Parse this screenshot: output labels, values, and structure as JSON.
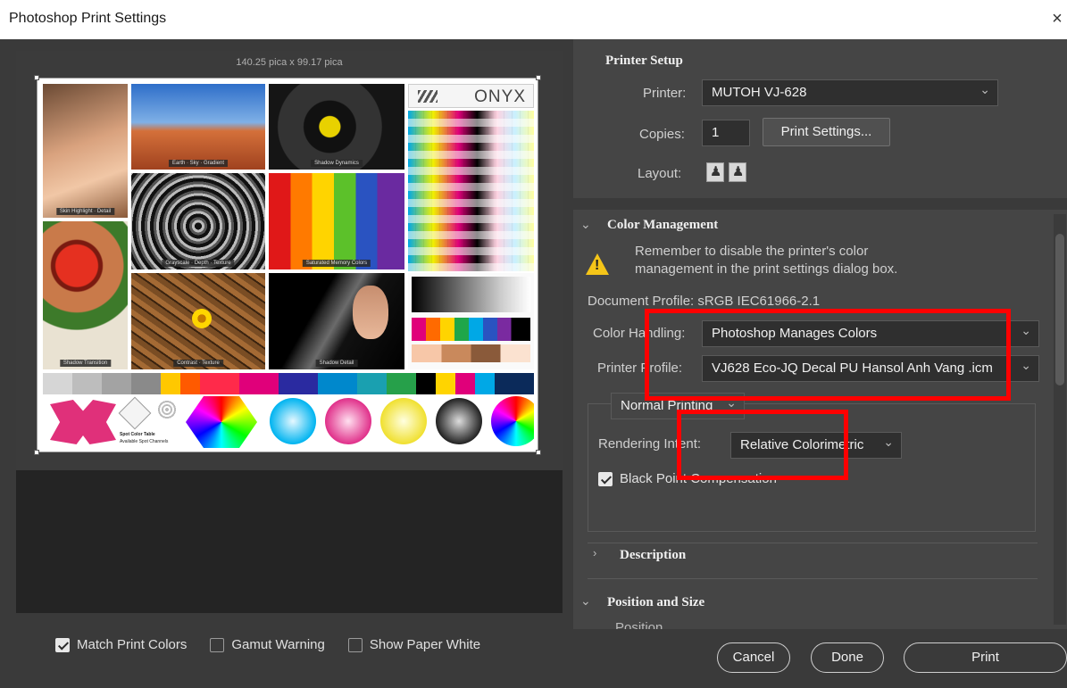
{
  "window": {
    "title": "Photoshop Print Settings",
    "close": "×"
  },
  "preview": {
    "dimensions": "140.25 pica x 99.17 pica",
    "logo": "ONYX",
    "captions": [
      "Skin Highlight · Detail",
      "Earth · Sky · Gradient",
      "Shadow Dynamics",
      "Grayscale · Depth · Texture",
      "Saturated Memory Colors",
      "Shadow Transition",
      "Contrast · Texture",
      "Shadow Detail",
      "Spot Color Table",
      "Available Spot Channels"
    ]
  },
  "bottom": {
    "match_print_colors": "Match Print Colors",
    "gamut_warning": "Gamut Warning",
    "show_paper_white": "Show Paper White"
  },
  "printer_setup": {
    "heading": "Printer Setup",
    "printer_label": "Printer:",
    "printer_value": "MUTOH VJ-628",
    "copies_label": "Copies:",
    "copies_value": "1",
    "print_settings_button": "Print Settings...",
    "layout_label": "Layout:"
  },
  "color_management": {
    "heading": "Color Management",
    "warning_line1": "Remember to disable the printer's color",
    "warning_line2": "management in the print settings dialog box.",
    "document_profile": "Document Profile: sRGB IEC61966-2.1",
    "color_handling_label": "Color Handling:",
    "color_handling_value": "Photoshop Manages Colors",
    "printer_profile_label": "Printer Profile:",
    "printer_profile_value": "VJ628 Eco-JQ Decal PU Hansol Anh Vang .icm",
    "normal_printing": "Normal Printing",
    "rendering_intent_label": "Rendering Intent:",
    "rendering_intent_value": "Relative Colorimetric",
    "black_point": "Black Point Compensation"
  },
  "sections": {
    "description": "Description",
    "position_and_size": "Position and Size",
    "position": "Position"
  },
  "buttons": {
    "cancel": "Cancel",
    "done": "Done",
    "print": "Print"
  },
  "colors": {
    "highlight": "#ff0000",
    "warning": "#f5c518",
    "panel": "#454545",
    "background": "#3a3a3a"
  }
}
